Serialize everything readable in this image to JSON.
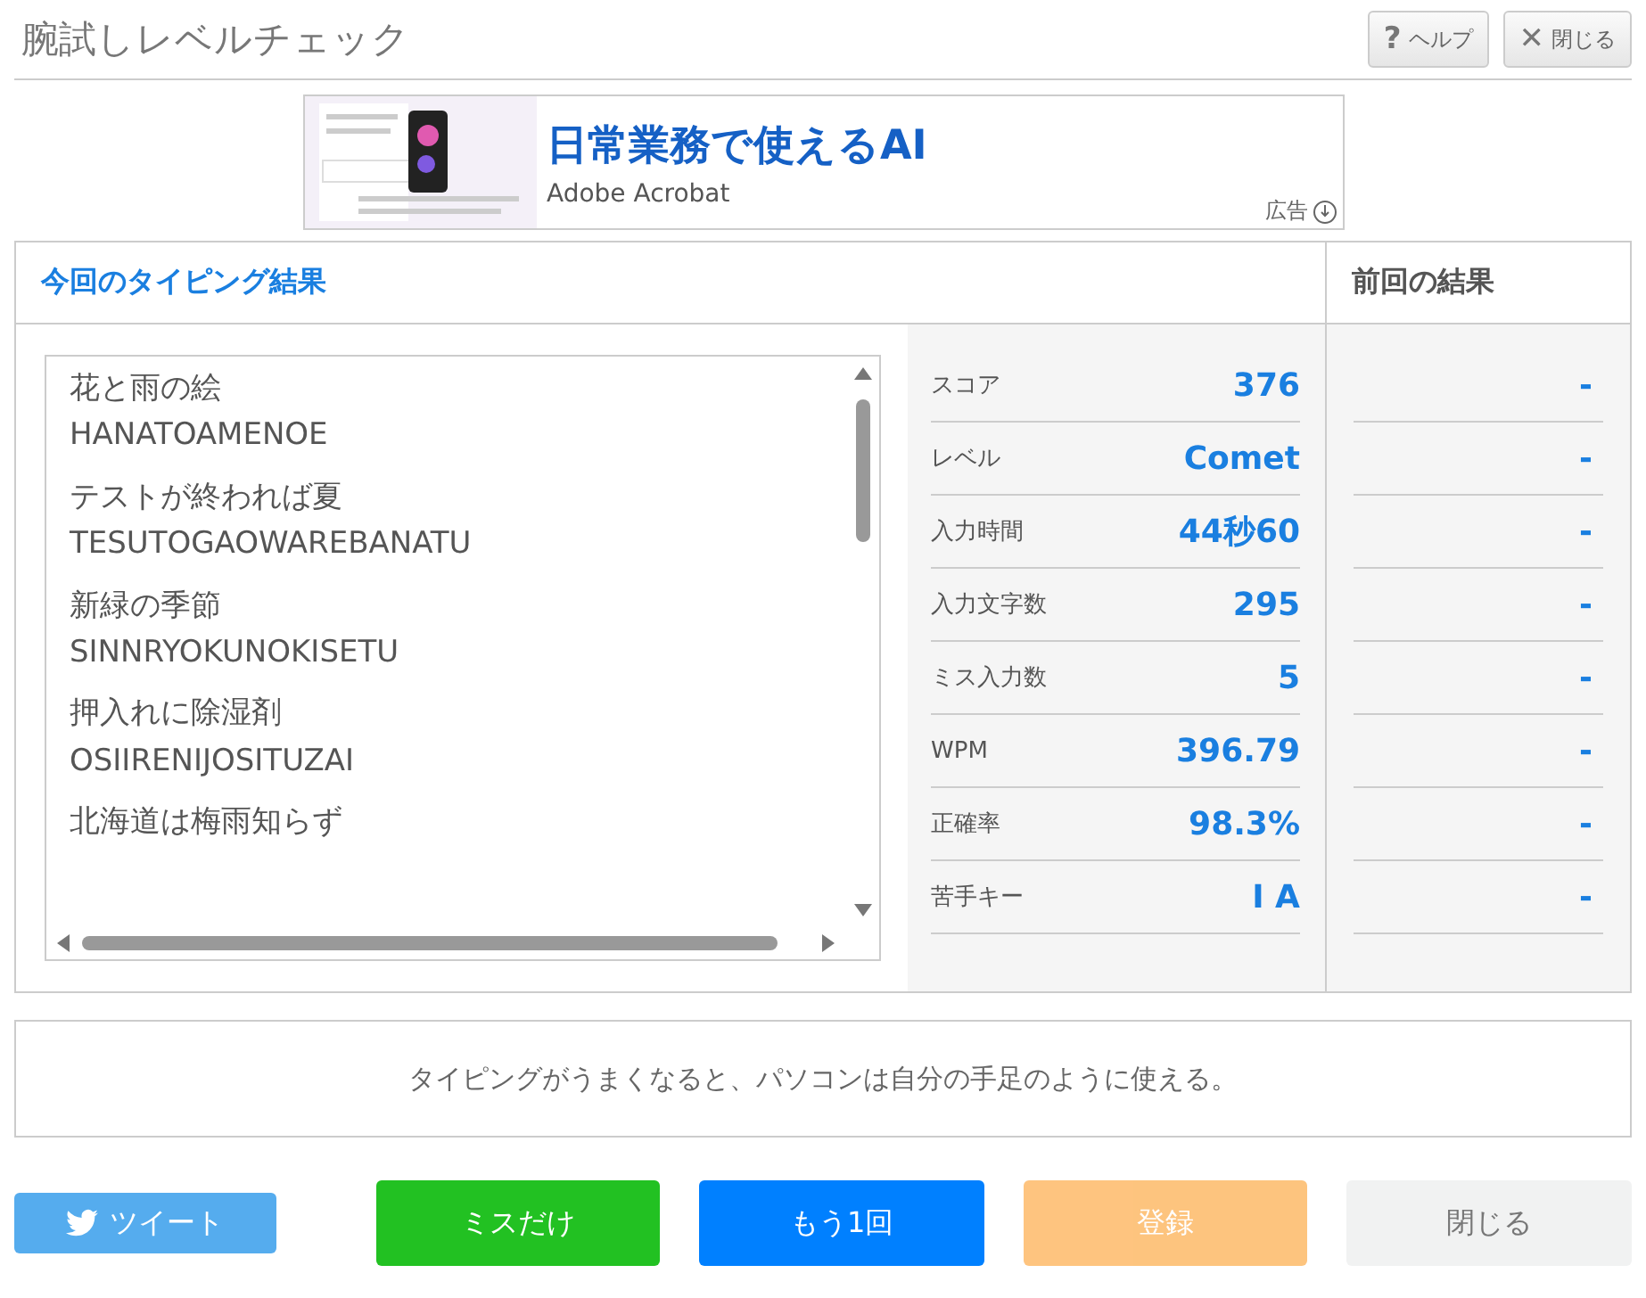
{
  "title": "腕試しレベルチェック",
  "header_buttons": [
    {
      "icon": "?",
      "label": "ヘルプ"
    },
    {
      "icon": "✕",
      "label": "閉じる"
    }
  ],
  "ad": {
    "kind": "picture",
    "headline": "日常業務で使えるAI",
    "advertiser": "Adobe Acrobat",
    "badge": "広告"
  },
  "current": {
    "heading": "今回のタイピング結果",
    "words": [
      {
        "text": "花と雨の絵",
        "romaji": "HANATOAMENOE"
      },
      {
        "text": "テストが終われば夏",
        "romaji": "TESUTOGAOWAREBANATU"
      },
      {
        "text": "新緑の季節",
        "romaji": "SINNRYOKUNOKISETU"
      },
      {
        "text": "押入れに除湿剤",
        "romaji": "OSIIRENIJOSITUZAI"
      },
      {
        "text": "北海道は梅雨知らず"
      }
    ],
    "stats": [
      {
        "label": "スコア",
        "value": "376"
      },
      {
        "label": "レベル",
        "value": "Comet"
      },
      {
        "label": "入力時間",
        "value": "44秒60"
      },
      {
        "label": "入力文字数",
        "value": "295"
      },
      {
        "label": "ミス入力数",
        "value": "5"
      },
      {
        "label": "WPM",
        "value": "396.79"
      },
      {
        "label": "正確率",
        "value": "98.3%"
      },
      {
        "label": "苦手キー",
        "value": "I A"
      }
    ]
  },
  "previous": {
    "heading": "前回の結果",
    "values": [
      "-",
      "-",
      "-",
      "-",
      "-",
      "-",
      "-",
      "-"
    ]
  },
  "message": "タイピングがうまくなると、パソコンは自分の手足のように使える。",
  "buttons": [
    {
      "kind": "tweet",
      "label": "ツイート",
      "disabled": false
    },
    {
      "kind": "miss",
      "label": "ミスだけ",
      "disabled": false
    },
    {
      "kind": "retry",
      "label": "もう1回",
      "disabled": false
    },
    {
      "kind": "register",
      "label": "登録",
      "disabled": true
    },
    {
      "kind": "close",
      "label": "閉じる",
      "disabled": false
    }
  ]
}
